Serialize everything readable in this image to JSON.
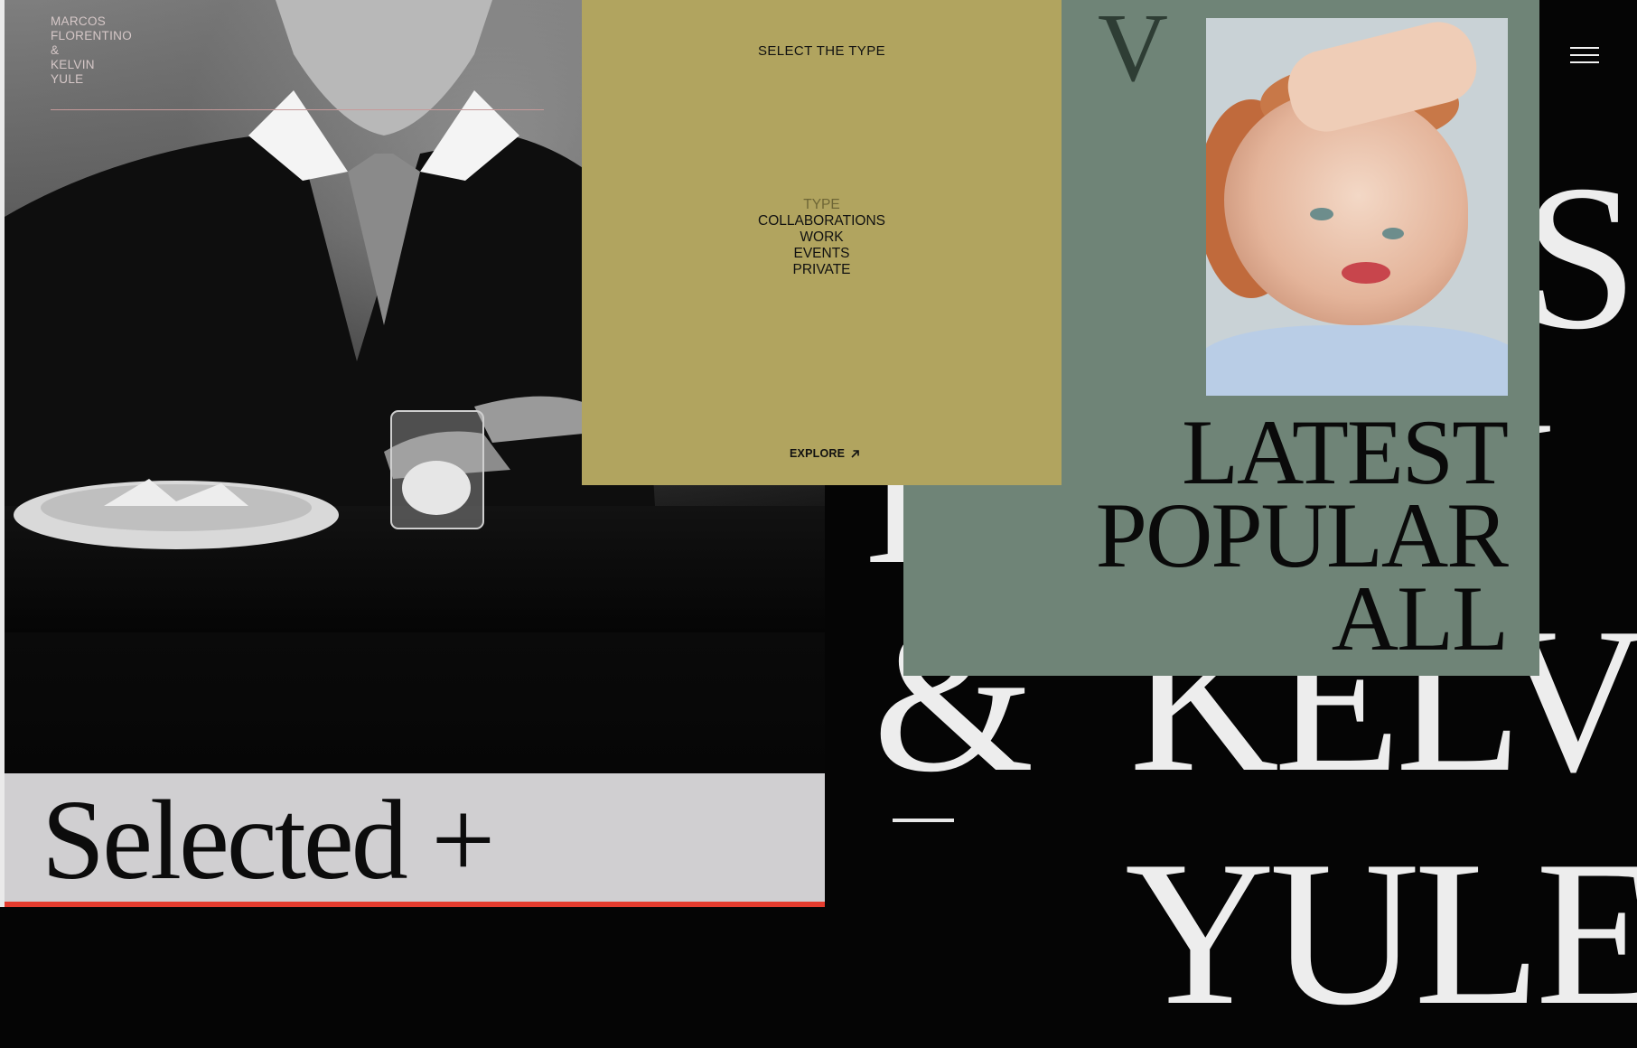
{
  "brand": {
    "name_lines": [
      "MARCOS",
      "FLORENTINO",
      "&",
      "KELVIN",
      "YULE"
    ],
    "monogram": "V"
  },
  "background_words": {
    "os": "OS",
    "i": "I",
    "n": "N",
    "amp": "&",
    "kelvi": "KELVI",
    "yule": "YULE"
  },
  "type_panel": {
    "title": "SELECT THE TYPE",
    "heading": "TYPE",
    "options": [
      "COLLABORATIONS",
      "WORK",
      "EVENTS",
      "PRIVATE"
    ],
    "explore_label": "EXPLORE",
    "explore_icon": "arrow-up-right-icon"
  },
  "filter_panel": {
    "options": [
      "LATEST",
      "POPULAR",
      "ALL"
    ]
  },
  "footer": {
    "selected_label": "Selected +"
  },
  "menu": {
    "icon": "hamburger-menu-icon"
  },
  "colors": {
    "olive": "#b1a45f",
    "sage": "#6f8477",
    "accent_red": "#e43c2e",
    "light_gray": "#d0cfd1"
  }
}
